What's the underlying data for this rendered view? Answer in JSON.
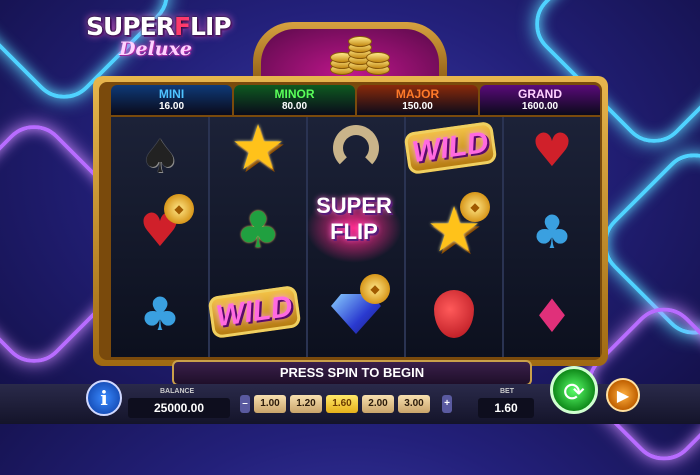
{
  "logo": {
    "line1_a": "SUPER",
    "line1_f": "F",
    "line1_b": "LIP",
    "line2": "Deluxe"
  },
  "jackpots": [
    {
      "name": "MINI",
      "value": "16.00",
      "color": "#4fc3ff",
      "bg": "#0e3a78"
    },
    {
      "name": "MINOR",
      "value": "80.00",
      "color": "#5aff5a",
      "bg": "#0e5a20"
    },
    {
      "name": "MAJOR",
      "value": "150.00",
      "color": "#ff7a2a",
      "bg": "#8a2a0a"
    },
    {
      "name": "GRAND",
      "value": "1600.00",
      "color": "#ffd1ff",
      "bg": "#5a0a7a"
    }
  ],
  "reel_symbols": [
    [
      "spade-icon",
      "heart-coin-icon",
      "club-icon"
    ],
    [
      "star-icon",
      "clover-icon",
      "wild-icon"
    ],
    [
      "horseshoe-icon",
      "superflip-logo",
      "diamond-coin-icon"
    ],
    [
      "wild-icon",
      "star-coin-icon",
      "strawberry-icon"
    ],
    [
      "heart-icon",
      "club-icon",
      "diamond-suit-icon"
    ]
  ],
  "center_logo": {
    "line1": "SUPER",
    "line2": "FLIP"
  },
  "wild_text": "WILD",
  "message": "PRESS SPIN TO BEGIN",
  "balance": {
    "label": "BALANCE",
    "value": "25000.00"
  },
  "bet_options": [
    "1.00",
    "1.20",
    "1.60",
    "2.00",
    "3.00"
  ],
  "bet_selected": "1.60",
  "bet": {
    "label": "BET",
    "value": "1.60"
  },
  "controls": {
    "minus": "–",
    "plus": "+",
    "info": "i",
    "spin": "⟳",
    "auto": "▶"
  }
}
